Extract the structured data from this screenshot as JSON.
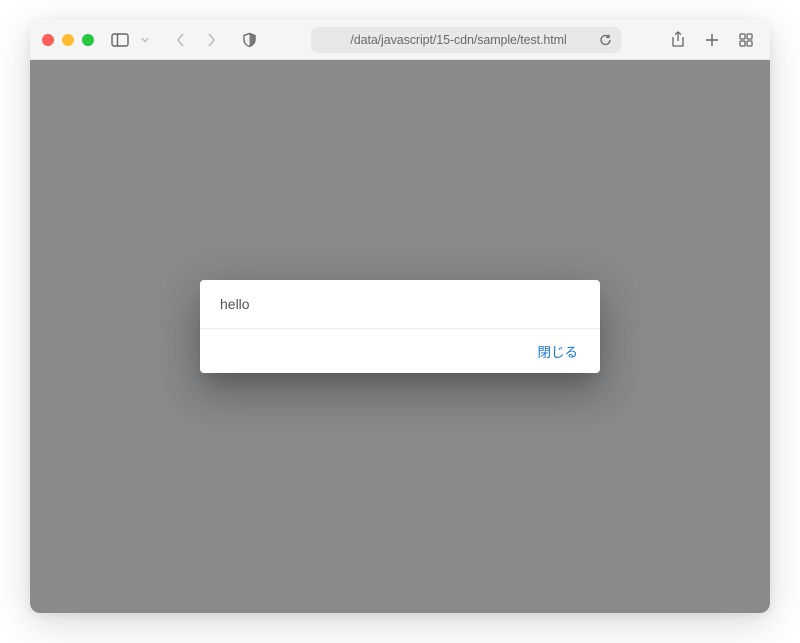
{
  "toolbar": {
    "address_text": "/data/javascript/15-cdn/sample/test.html"
  },
  "dialog": {
    "message": "hello",
    "close_label": "閉じる"
  }
}
